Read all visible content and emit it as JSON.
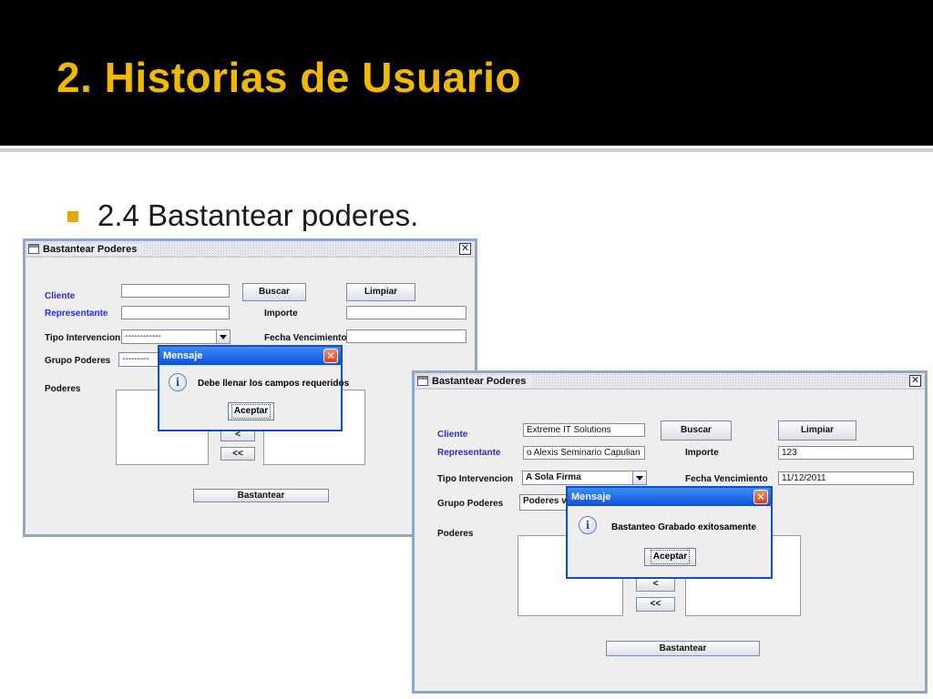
{
  "slide": {
    "title": "2. Historias de Usuario",
    "bullet": "2.4 Bastantear poderes."
  },
  "colors": {
    "title": "#f0b800",
    "bullet": "#e8a800",
    "header_bg": "#000000",
    "dialog_title": "#0a52d8",
    "field_label_blue": "#2b2bd0"
  },
  "window1": {
    "title": "Bastantear Poderes",
    "cliente_label": "Cliente",
    "representante_label": "Representante",
    "tipo_label": "Tipo Intervencion",
    "grupo_label": "Grupo Poderes",
    "poderes_label": "Poderes",
    "importe_label": "Importe",
    "fecha_label": "Fecha Vencimiento",
    "buscar": "Buscar",
    "limpiar": "Limpiar",
    "tipo_value": "------------",
    "grupo_value": "---------",
    "move_left": "<",
    "move_all_left": "<<",
    "bastantear": "Bastantear",
    "dialog": {
      "title": "Mensaje",
      "message": "Debe llenar los campos requeridos",
      "ok": "Aceptar",
      "icon": "info-icon"
    }
  },
  "window2": {
    "title": "Bastantear Poderes",
    "cliente_label": "Cliente",
    "representante_label": "Representante",
    "tipo_label": "Tipo Intervencion",
    "grupo_label": "Grupo Poderes",
    "poderes_label": "Poderes",
    "importe_label": "Importe",
    "fecha_label": "Fecha Vencimiento",
    "buscar": "Buscar",
    "limpiar": "Limpiar",
    "cliente_value": "Extreme IT Solutions",
    "representante_value": "o Alexis Seminario Capulian",
    "importe_value": "123",
    "fecha_value": "11/12/2011",
    "tipo_value": "A Sola Firma",
    "grupo_value": "Poderes v",
    "move_left": "<",
    "move_all_left": "<<",
    "bastantear": "Bastantear",
    "dialog": {
      "title": "Mensaje",
      "message": "Bastanteo Grabado exitosamente",
      "ok": "Aceptar",
      "icon": "info-icon"
    }
  }
}
